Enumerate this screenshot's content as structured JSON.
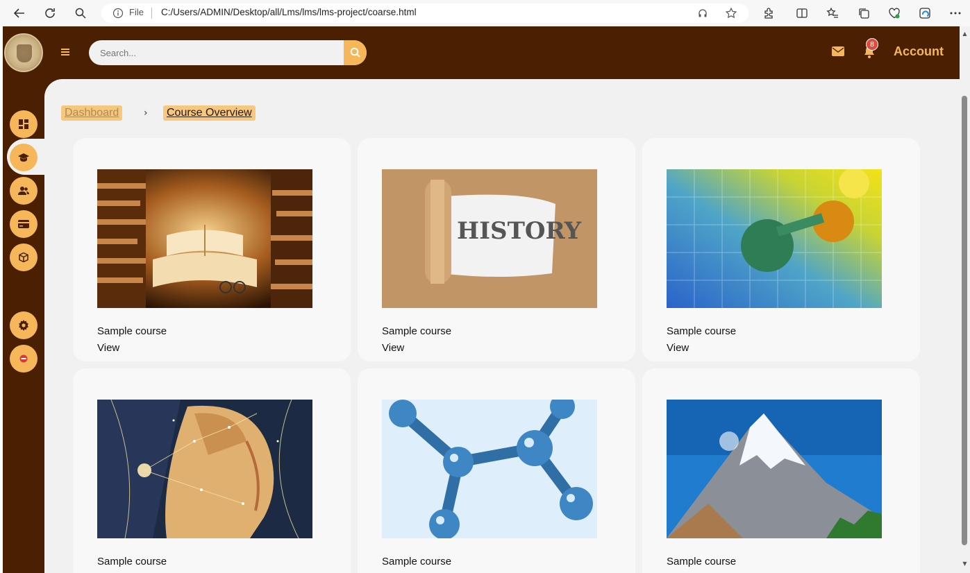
{
  "browser": {
    "file_label": "File",
    "url": "C:/Users/ADMIN/Desktop/all/Lms/lms/lms-project/coarse.html"
  },
  "header": {
    "search_placeholder": "Search...",
    "notification_count": "8",
    "account_label": "Account"
  },
  "sidebar": {
    "items": [
      {
        "icon": "dashboard-icon"
      },
      {
        "icon": "graduation-cap-icon"
      },
      {
        "icon": "users-icon"
      },
      {
        "icon": "credit-card-icon"
      },
      {
        "icon": "box-icon"
      },
      {
        "icon": "gear-icon"
      },
      {
        "icon": "logout-icon"
      }
    ]
  },
  "breadcrumb": {
    "home": "Dashboard",
    "separator": "›",
    "current": "Course Overview"
  },
  "courses": [
    {
      "title": "Sample course",
      "link": "View",
      "image": "library-books-image"
    },
    {
      "title": "Sample course",
      "link": "View",
      "image": "history-image",
      "image_text": "HISTORY"
    },
    {
      "title": "Sample course",
      "link": "View",
      "image": "periodic-table-image"
    },
    {
      "title": "Sample course",
      "image": "constellation-head-image"
    },
    {
      "title": "Sample course",
      "image": "molecule-image"
    },
    {
      "title": "Sample course",
      "image": "mountain-image"
    }
  ],
  "colors": {
    "brand_dark": "#4a1f02",
    "accent": "#f5b75a",
    "content_bg": "#f1f1f1",
    "card_bg": "#f8f8f8",
    "badge": "#e04a3b"
  }
}
